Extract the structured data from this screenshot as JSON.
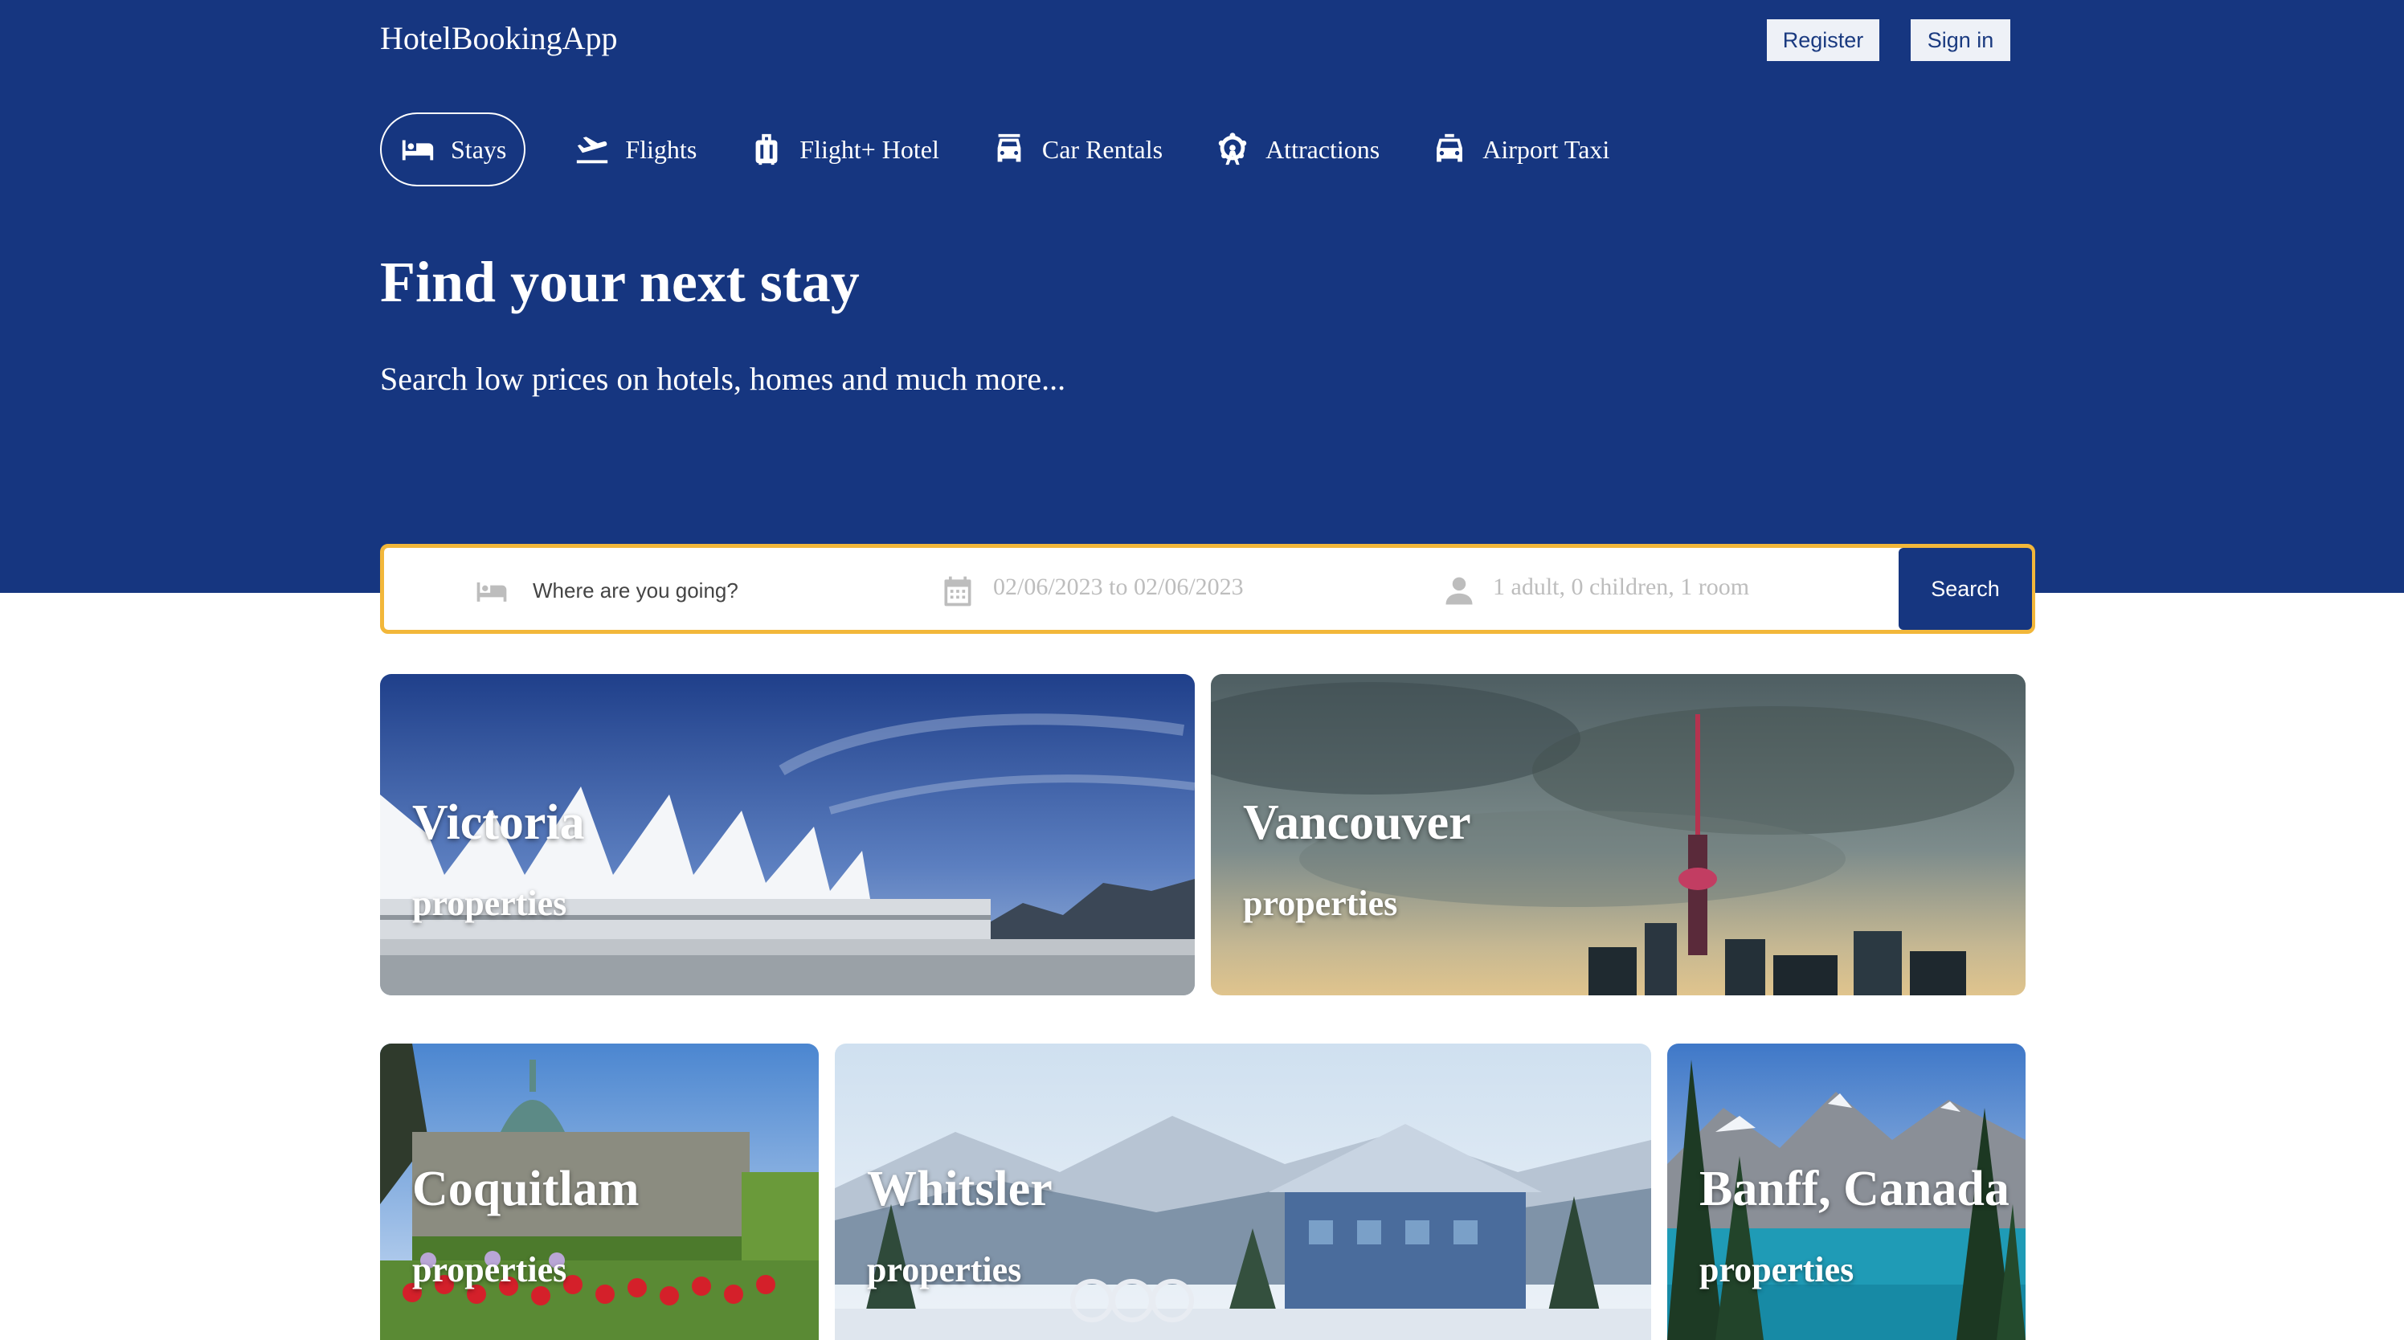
{
  "header": {
    "brand": "HotelBookingApp",
    "register_label": "Register",
    "signin_label": "Sign in"
  },
  "nav": {
    "items": [
      {
        "label": "Stays",
        "icon": "bed-icon",
        "active": true
      },
      {
        "label": "Flights",
        "icon": "plane-icon"
      },
      {
        "label": "Flight+ Hotel",
        "icon": "luggage-icon"
      },
      {
        "label": "Car Rentals",
        "icon": "car-icon"
      },
      {
        "label": "Attractions",
        "icon": "ferris-wheel-icon"
      },
      {
        "label": "Airport Taxi",
        "icon": "taxi-icon"
      }
    ]
  },
  "hero": {
    "title": "Find your next stay",
    "subtitle": "Search low prices on hotels, homes and much more..."
  },
  "search": {
    "destination_placeholder": "Where are you going?",
    "dates": "02/06/2023 to 02/06/2023",
    "guests": "1 adult, 0 children, 1 room",
    "button_label": "Search"
  },
  "destinations": [
    {
      "city": "Victoria",
      "subtitle": "properties"
    },
    {
      "city": "Vancouver",
      "subtitle": "properties"
    },
    {
      "city": "Coquitlam",
      "subtitle": "properties"
    },
    {
      "city": "Whitsler",
      "subtitle": "properties"
    },
    {
      "city": "Banff, Canada",
      "subtitle": "properties"
    }
  ],
  "colors": {
    "brand_blue": "#163680",
    "search_border": "#f2b73a",
    "placeholder_grey": "#bdbdbd"
  }
}
